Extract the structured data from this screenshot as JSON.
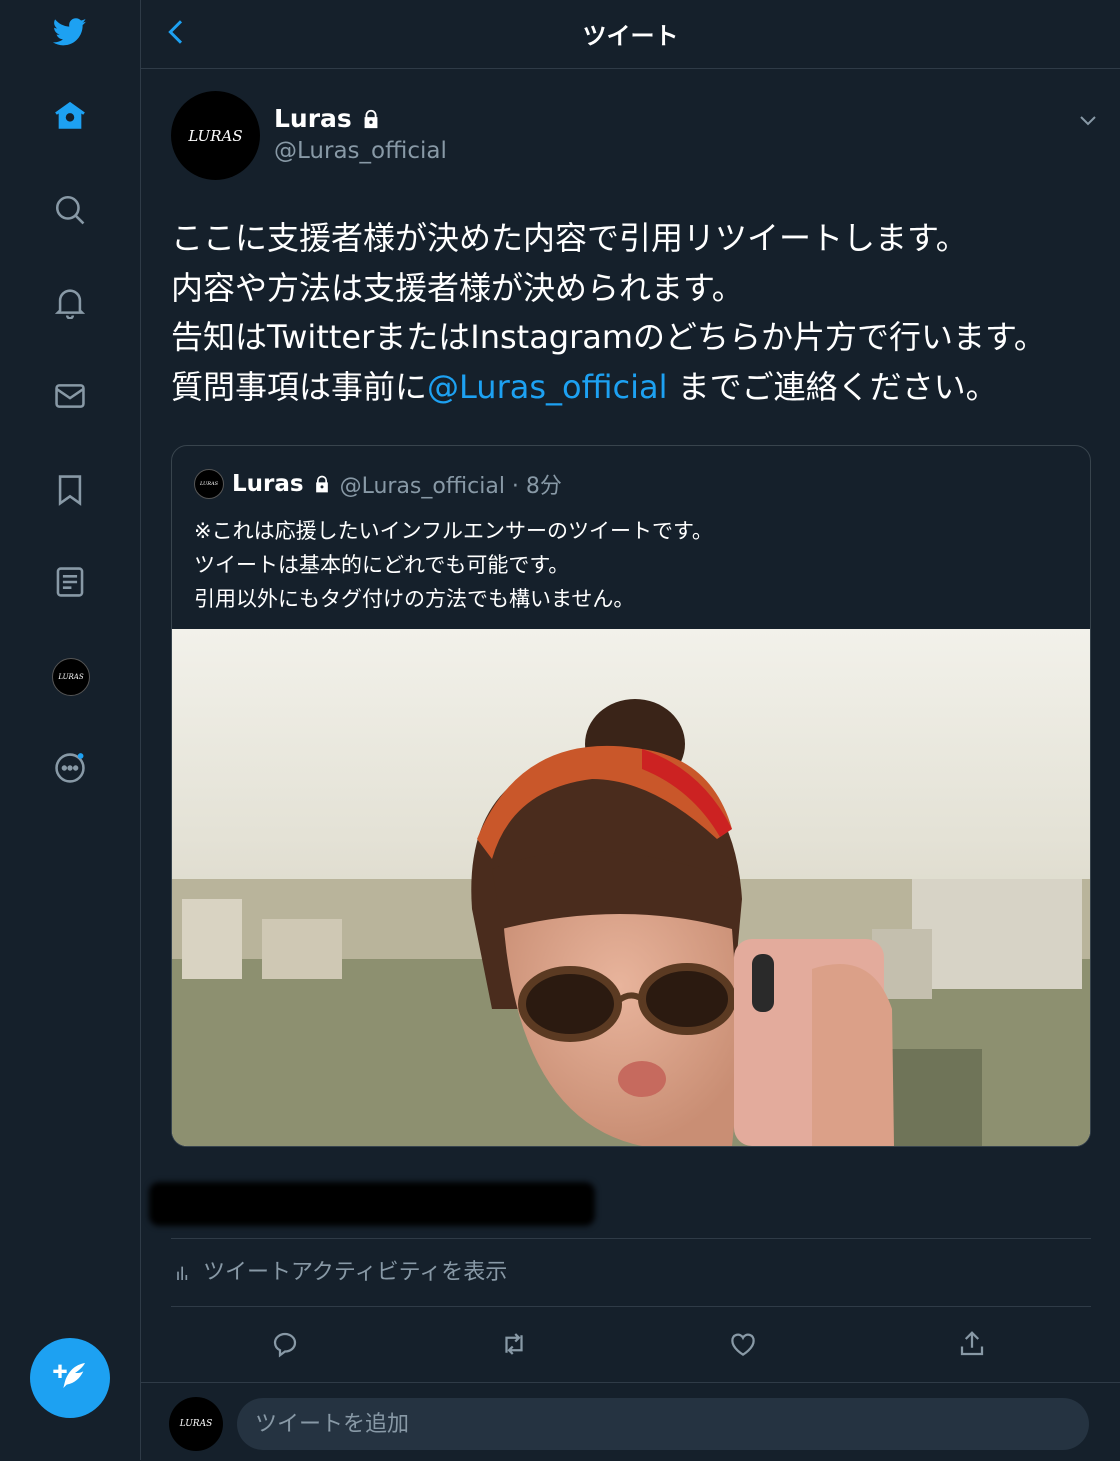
{
  "header": {
    "title": "ツイート"
  },
  "tweet": {
    "author_name": "Luras",
    "author_handle": "@Luras_official",
    "avatar_text": "LURAS",
    "text_lines": [
      "ここに支援者様が決めた内容で引用リツイートします。",
      "内容や方法は支援者様が決められます。",
      "告知はTwitterまたはInstagramのどちらか片方で行います。"
    ],
    "last_line_before": "質問事項は事前に",
    "last_line_mention": "@Luras_official",
    "last_line_after": " までご連絡ください。"
  },
  "quote": {
    "author_name": "Luras",
    "meta": "@Luras_official · 8分",
    "text_lines": [
      "※これは応援したいインフルエンサーのツイートです。",
      "ツイートは基本的にどれでも可能です。",
      "引用以外にもタグ付けの方法でも構いません。"
    ]
  },
  "activity_label": "ツイートアクティビティを表示",
  "reply": {
    "placeholder": "ツイートを追加"
  },
  "colors": {
    "background": "#15202b",
    "accent": "#1da1f2",
    "muted": "#8899a6",
    "border": "#2f3b47"
  },
  "icons": {
    "sidebar": [
      "twitter-logo-icon",
      "home-icon",
      "search-icon",
      "bell-icon",
      "mail-icon",
      "bookmark-icon",
      "list-icon",
      "profile-avatar",
      "more-icon"
    ],
    "actions": [
      "reply-icon",
      "retweet-icon",
      "like-icon",
      "share-icon"
    ]
  }
}
